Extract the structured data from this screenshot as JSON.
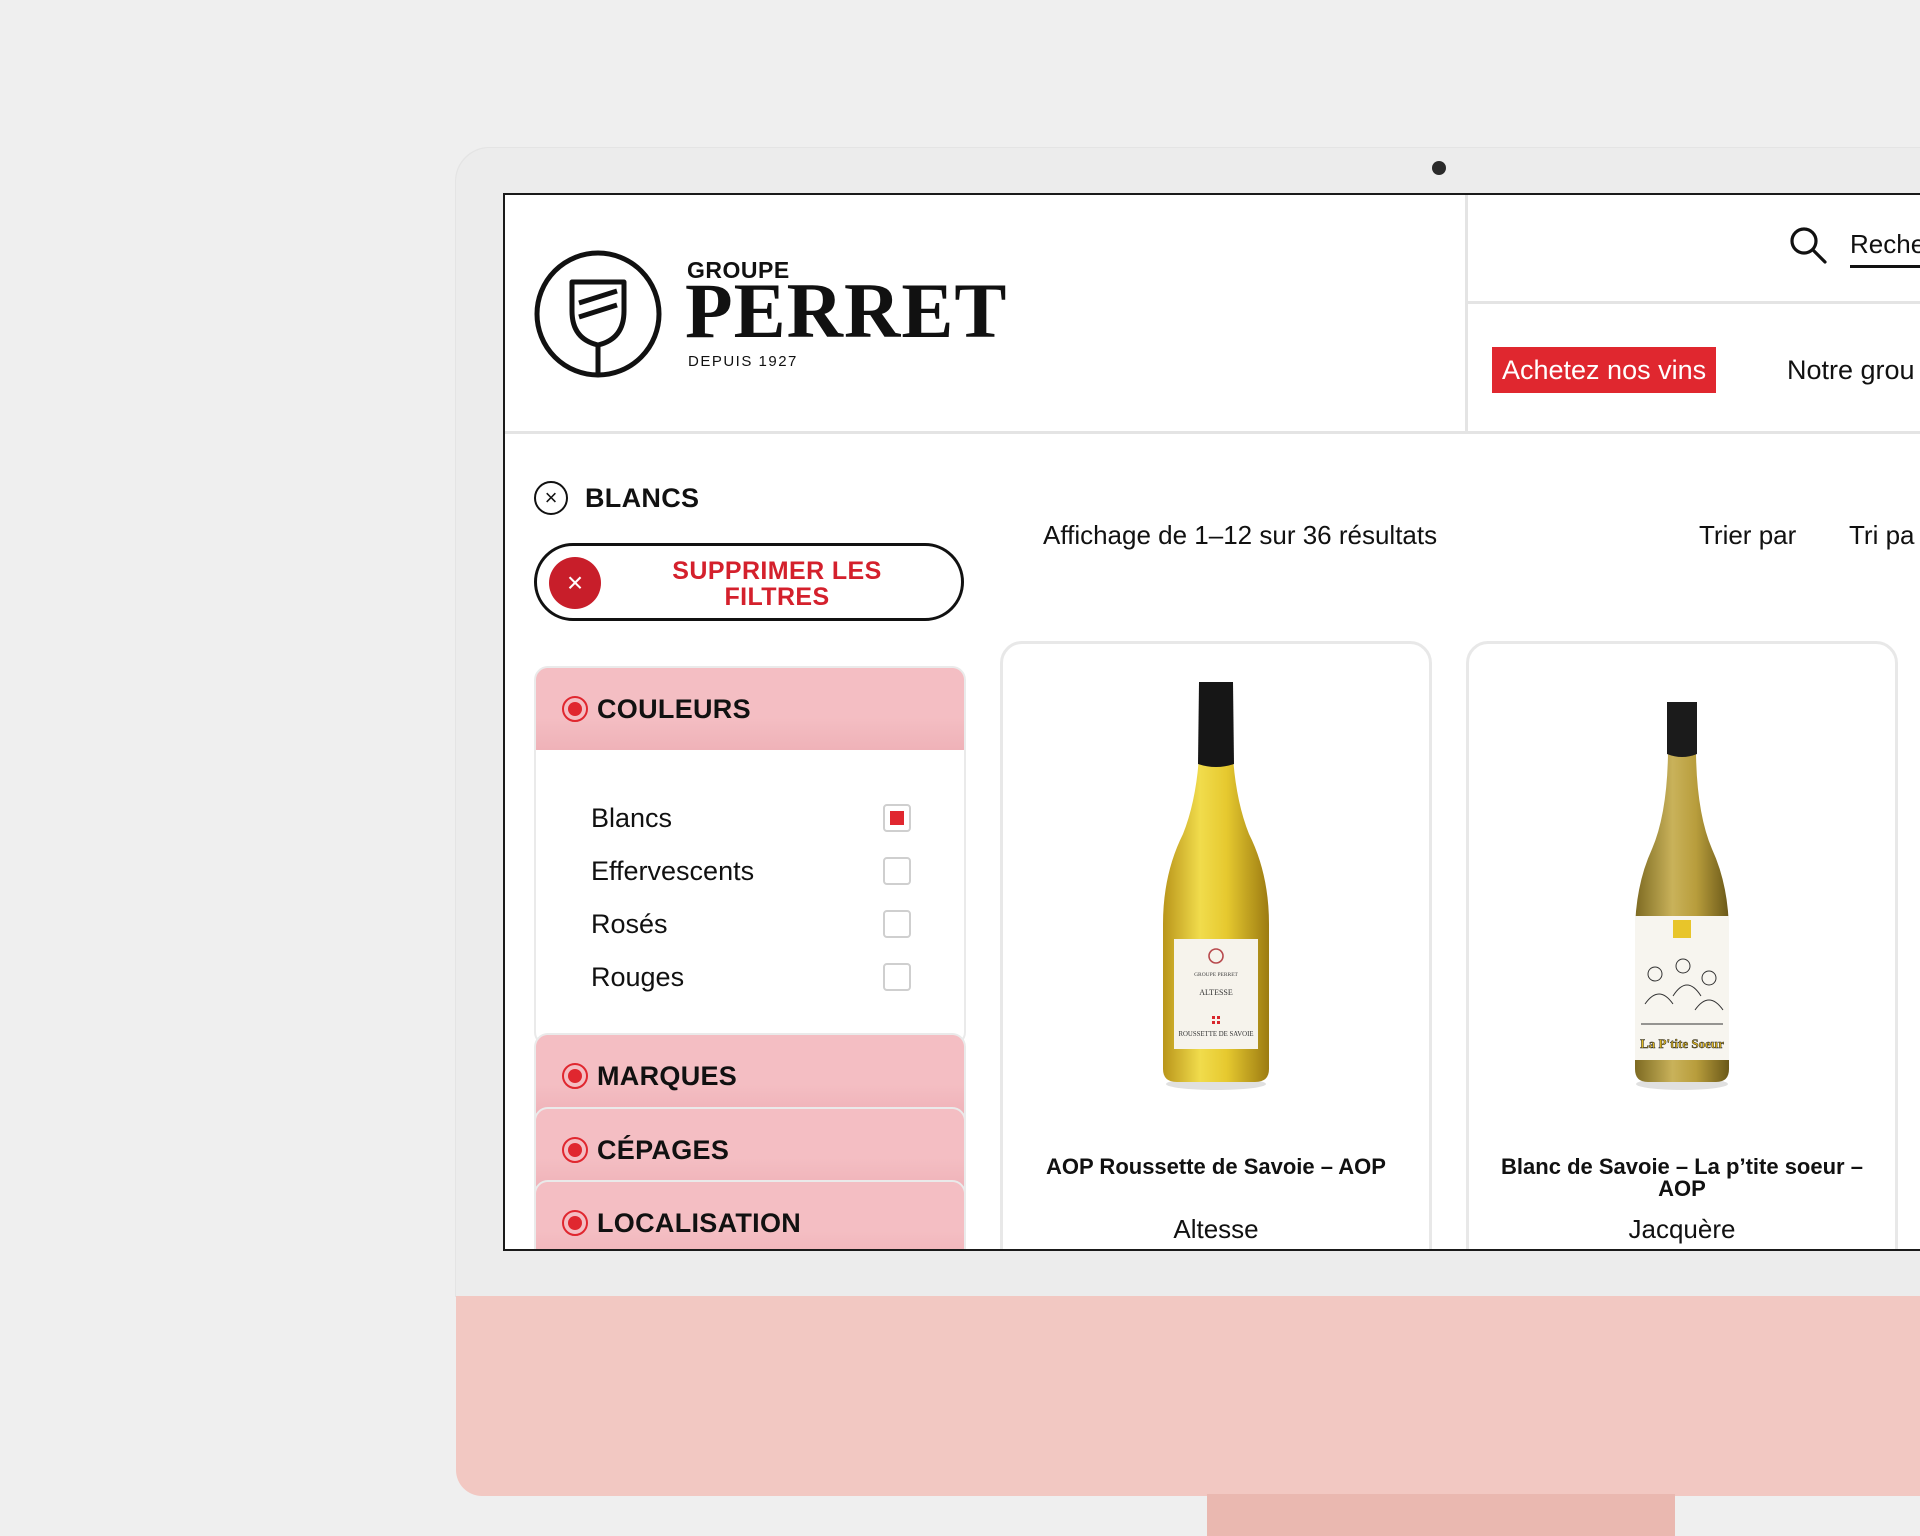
{
  "brand": {
    "line1": "GROUPE",
    "line2": "PERRET",
    "tagline": "DEPUIS 1927"
  },
  "search": {
    "placeholder": "Reche"
  },
  "nav": {
    "cta": "Achetez nos vins",
    "link": "Notre grou"
  },
  "active_filter": {
    "label": "BLANCS"
  },
  "clear_filters": {
    "label": "SUPPRIMER LES FILTRES"
  },
  "facets": [
    {
      "title": "COULEURS",
      "options": [
        {
          "label": "Blancs",
          "checked": true
        },
        {
          "label": "Effervescents",
          "checked": false
        },
        {
          "label": "Rosés",
          "checked": false
        },
        {
          "label": "Rouges",
          "checked": false
        }
      ]
    },
    {
      "title": "MARQUES"
    },
    {
      "title": "CÉPAGES"
    },
    {
      "title": "LOCALISATION"
    }
  ],
  "results": {
    "count_text": "Affichage de 1–12 sur 36 résultats",
    "sort_label": "Trier par",
    "sort_value": "Tri pa"
  },
  "products": [
    {
      "name": "AOP Roussette de Savoie – AOP",
      "variety": "Altesse",
      "label_brand": "ROUSSETTE DE SAVOIE",
      "label_cuvee": "ALTESSE"
    },
    {
      "name": "Blanc de Savoie – La p’tite soeur – AOP",
      "variety": "Jacquère",
      "label_brand": "La P'tite Soeur"
    }
  ],
  "colors": {
    "accent": "#e0272f",
    "facet_bg": "#f4bec3",
    "chin": "#f2c8c2",
    "background": "#efefef"
  }
}
